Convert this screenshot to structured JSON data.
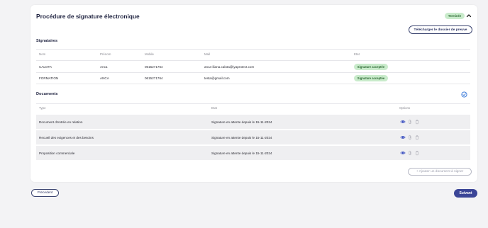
{
  "procedure": {
    "title": "Procédure de signature électronique",
    "status_badge": "Terminée",
    "download_proof_label": "Télécharger le dossier de preuve"
  },
  "signataires": {
    "section_title": "Signataires",
    "columns": [
      "Nom",
      "Prénom",
      "Mobile",
      "Mail",
      "Etat"
    ],
    "rows": [
      {
        "nom": "CALOTA",
        "prenom": "Anca",
        "mobile": "0615271764",
        "mail": "anca-iliana.calota@iyaprotect.com",
        "etat": "Signature acceptée"
      },
      {
        "nom": "FORMATION",
        "prenom": "ANCA",
        "mobile": "0615271764",
        "mail": "testa@gmail.com",
        "etat": "Signature acceptée"
      }
    ]
  },
  "documents": {
    "section_title": "Documents",
    "columns": [
      "Type",
      "Etat",
      "Options"
    ],
    "rows": [
      {
        "type": "Document d'entrée en relation",
        "etat": "Signature en attente depuis le 15-11-2024"
      },
      {
        "type": "Recueil des exigences et des besoins",
        "etat": "Signature en attente depuis le 15-11-2024"
      },
      {
        "type": "Proposition commerciale",
        "etat": "Signature en attente depuis le 15-11-2024"
      }
    ],
    "add_label": "+ Ajouter un document à signer"
  },
  "footer": {
    "prev_label": "Précédent",
    "next_label": "Suivant"
  },
  "colors": {
    "primary": "#3b4597",
    "badge_green_bg": "#c9ebcb",
    "badge_green_text": "#2f6b35",
    "check_blue": "#2a6fd6",
    "eye_blue": "#3a4fc0"
  },
  "icons": {
    "collapse": "chevron-up-icon",
    "documents_status": "check-circle-icon",
    "view": "eye-icon",
    "attach": "paperclip-icon",
    "delete": "trash-icon"
  }
}
